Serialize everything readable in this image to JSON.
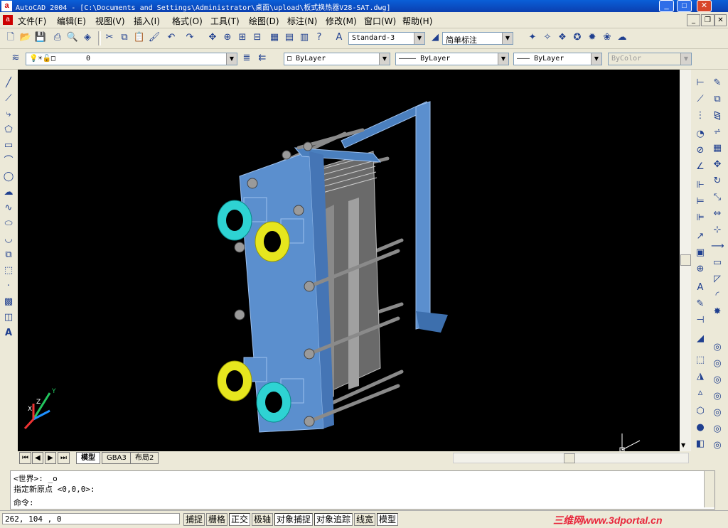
{
  "window": {
    "title": "AutoCAD 2004 - [C:\\Documents and Settings\\Administrator\\桌面\\upload\\板式换热器V28-SAT.dwg]",
    "app_icon_letter": "a",
    "min_glyph": "_",
    "max_glyph": "□",
    "close_glyph": "✕"
  },
  "menu": {
    "items": [
      "文件(F)",
      "编辑(E)",
      "视图(V)",
      "插入(I)",
      "格式(O)",
      "工具(T)",
      "绘图(D)",
      "标注(N)",
      "修改(M)",
      "窗口(W)",
      "帮助(H)"
    ]
  },
  "toolbar": {
    "text_style": "Standard-3",
    "dim_style": "简单标注"
  },
  "layers": {
    "current": "0",
    "color": "ByLayer",
    "linetype": "ByLayer",
    "lineweight": "ByLayer",
    "plotstyle": "ByColor"
  },
  "tabs": [
    "模型",
    "GBA3",
    "布局2"
  ],
  "command": {
    "lines": [
      "<世界>: _o",
      "指定新原点 <0,0,0>:",
      "命令:"
    ]
  },
  "status": {
    "coords": "262,  104  , 0",
    "buttons": [
      "捕捉",
      "栅格",
      "正交",
      "极轴",
      "对象捕捉",
      "对象追踪",
      "线宽",
      "模型"
    ],
    "active": [
      "正交",
      "对象捕捉",
      "对象追踪",
      "模型"
    ],
    "watermark": "三维网www.3dportal.cn"
  },
  "ucs": {
    "x": "X",
    "y": "Y",
    "z": "Z"
  },
  "colors": {
    "plate": "#5b8fce",
    "flange_cyan": "#2ed3d3",
    "flange_yellow": "#e6e61e",
    "canvas": "#000000"
  }
}
